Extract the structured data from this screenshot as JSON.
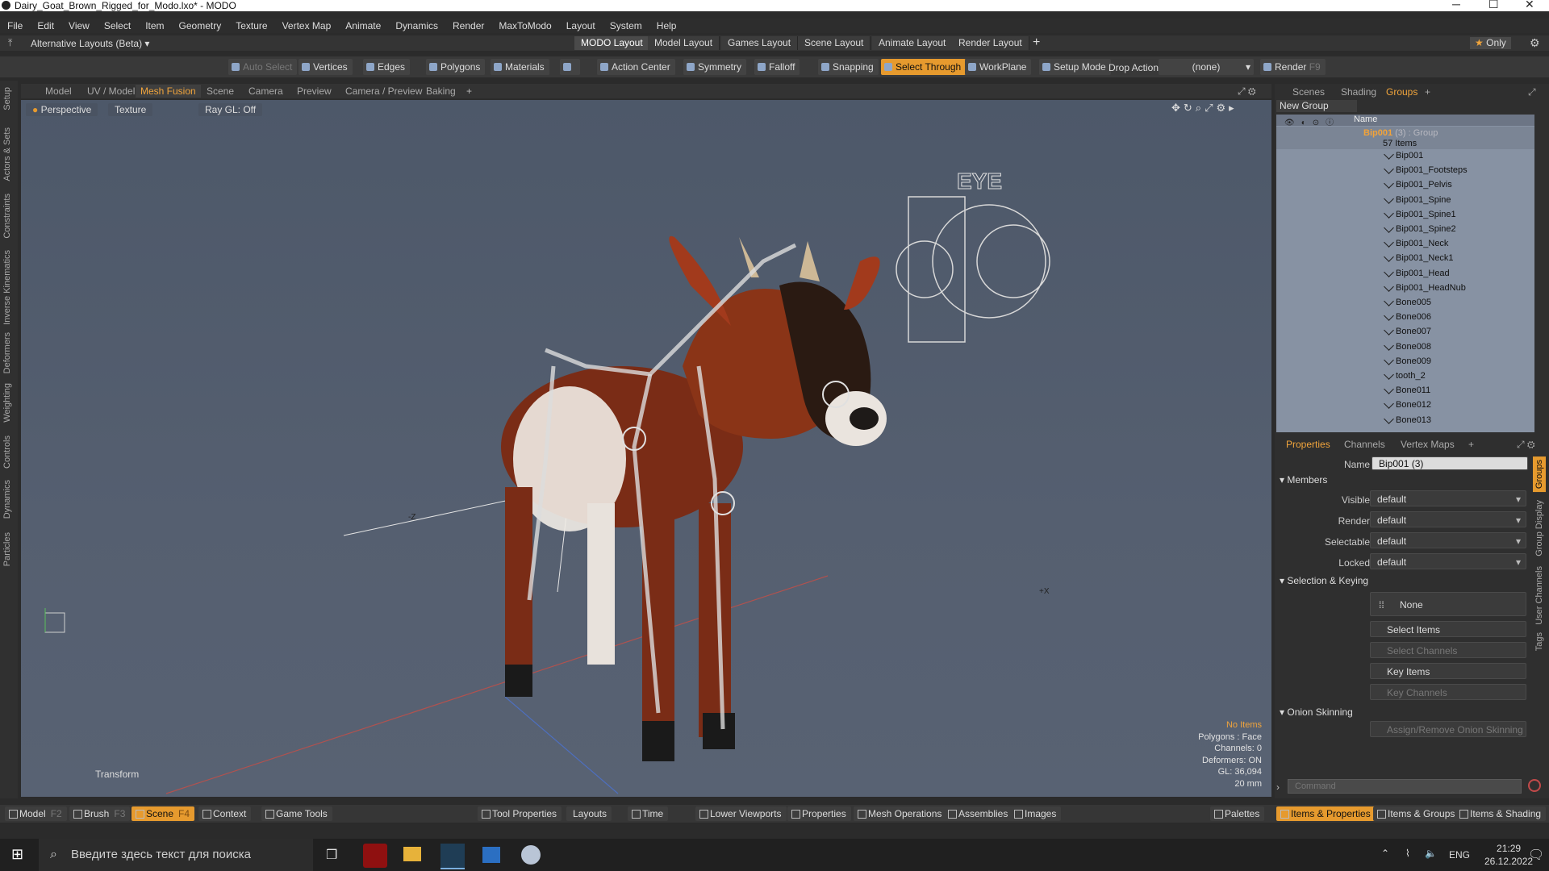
{
  "window": {
    "title": "Dairy_Goat_Brown_Rigged_for_Modo.lxo* - MODO"
  },
  "menu": [
    "File",
    "Edit",
    "View",
    "Select",
    "Item",
    "Geometry",
    "Texture",
    "Vertex Map",
    "Animate",
    "Dynamics",
    "Render",
    "MaxToModo",
    "Layout",
    "System",
    "Help"
  ],
  "layoutbar": {
    "alt_layouts": "Alternative Layouts (Beta)",
    "tabs": [
      "MODO Layout",
      "Model Layout",
      "Games Layout",
      "Scene Layout",
      "Animate Layout",
      "Render Layout"
    ],
    "only": "Only"
  },
  "toolbar": {
    "auto_select": "Auto Select",
    "vertices": "Vertices",
    "edges": "Edges",
    "polygons": "Polygons",
    "materials": "Materials",
    "action_center": "Action Center",
    "symmetry": "Symmetry",
    "falloff": "Falloff",
    "snapping": "Snapping",
    "select_through": "Select Through",
    "workplane": "WorkPlane",
    "setup_mode": "Setup Mode",
    "drop_action": "Drop Action",
    "drop_value": "(none)",
    "render": "Render",
    "render_key": "F9"
  },
  "left_tabs": [
    "Setup",
    "Actors & Sets",
    "Constraints",
    "Inverse Kinematics",
    "Deformers",
    "Weighting",
    "Controls",
    "Dynamics",
    "Particles"
  ],
  "viewport_tabs": [
    "Model",
    "UV / Model",
    "Mesh Fusion",
    "Scene",
    "Camera",
    "Preview",
    "Camera / Preview",
    "Baking"
  ],
  "viewport": {
    "perspective": "Perspective",
    "texture": "Texture",
    "raygl": "Ray GL: Off",
    "eye_label": "EYE",
    "axis_z": "-Z",
    "axis_x": "+X",
    "transform": "Transform",
    "info": [
      "No Items",
      "Polygons : Face",
      "Channels: 0",
      "Deformers: ON",
      "GL: 36,094",
      "20 mm"
    ]
  },
  "right_tabs": [
    "Scenes",
    "Shading",
    "Groups"
  ],
  "groups": {
    "new_group": "New Group",
    "name_col": "Name",
    "root": "Bip001",
    "root_suffix": "(3) : Group",
    "count": "57 Items",
    "items": [
      "Bip001",
      "Bip001_Footsteps",
      "Bip001_Pelvis",
      "Bip001_Spine",
      "Bip001_Spine1",
      "Bip001_Spine2",
      "Bip001_Neck",
      "Bip001_Neck1",
      "Bip001_Head",
      "Bip001_HeadNub",
      "Bone005",
      "Bone006",
      "Bone007",
      "Bone008",
      "Bone009",
      "tooth_2",
      "Bone011",
      "Bone012",
      "Bone013"
    ]
  },
  "prop_tabs": [
    "Properties",
    "Channels",
    "Vertex Maps"
  ],
  "side_tabs": [
    "Groups",
    "Group Display",
    "User Channels",
    "Tags"
  ],
  "properties": {
    "name_label": "Name",
    "name_value": "Bip001 (3)",
    "members": "Members",
    "visible_label": "Visible",
    "render_label": "Render",
    "selectable_label": "Selectable",
    "locked_label": "Locked",
    "default": "default",
    "sel_keying": "Selection & Keying",
    "none": "None",
    "select_items": "Select Items",
    "select_channels": "Select Channels",
    "key_items": "Key Items",
    "key_channels": "Key Channels",
    "onion": "Onion Skinning",
    "assign_onion": "Assign/Remove Onion Skinning",
    "command_placeholder": "Command"
  },
  "bottombar": {
    "model": "Model",
    "model_key": "F2",
    "brush": "Brush",
    "brush_key": "F3",
    "scene": "Scene",
    "scene_key": "F4",
    "context": "Context",
    "game_tools": "Game Tools",
    "tool_properties": "Tool Properties",
    "layouts": "Layouts",
    "time": "Time",
    "lower_viewports": "Lower Viewports",
    "properties": "Properties",
    "mesh_operations": "Mesh Operations",
    "assemblies": "Assemblies",
    "images": "Images",
    "palettes": "Palettes",
    "items_properties": "Items & Properties",
    "items_groups": "Items & Groups",
    "items_shading": "Items & Shading"
  },
  "taskbar": {
    "search": "Введите здесь текст для поиска",
    "lang": "ENG",
    "time": "21:29",
    "date": "26.12.2022"
  }
}
